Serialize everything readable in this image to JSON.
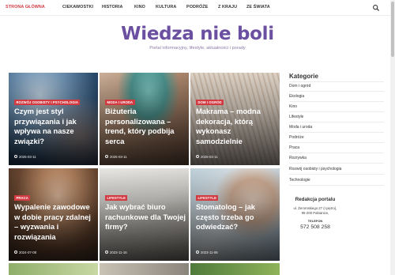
{
  "nav": {
    "items": [
      {
        "label": "STRONA GŁÓWNA",
        "active": true
      },
      {
        "label": "CIEKAWOSTKI",
        "active": false
      },
      {
        "label": "HISTORIA",
        "active": false
      },
      {
        "label": "KINO",
        "active": false
      },
      {
        "label": "KULTURA",
        "active": false
      },
      {
        "label": "PODRÓŻE",
        "active": false
      },
      {
        "label": "Z KRAJU",
        "active": false
      },
      {
        "label": "ZE ŚWIATA",
        "active": false
      }
    ],
    "search_icon": "search-icon"
  },
  "header": {
    "title": "Wiedza nie boli",
    "tagline": "Portal informacyjny, lifestyle, aktualności i porady"
  },
  "cards": [
    {
      "category": "ROZWÓJ OSOBISTY I PSYCHOLOGIA",
      "title": "Czym jest styl przywiązania i jak wpływa na nasze związki?",
      "date": "2025-03-11"
    },
    {
      "category": "MODA I URODA",
      "title": "Biżuteria personalizowana – trend, który podbija serca",
      "date": "2025-03-11"
    },
    {
      "category": "DOM I OGRÓD",
      "title": "Makrama – modna dekoracja, którą wykonasz samodzielnie",
      "date": "2025-03-11"
    },
    {
      "category": "PRACA",
      "title": "Wypalenie zawodowe w dobie pracy zdalnej – wyzwania i rozwiązania",
      "date": "2024-07-08"
    },
    {
      "category": "LIFESTYLE",
      "title": "Jak wybrać biuro rachunkowe dla Twojej firmy?",
      "date": "2023-11-16"
    },
    {
      "category": "LIFESTYLE",
      "title": "Stomatolog – jak często trzeba go odwiedzać?",
      "date": "2023-11-06"
    }
  ],
  "sidebar": {
    "heading": "Kategorie",
    "categories": [
      "Dom i ogród",
      "Ekologia",
      "Kino",
      "Lifestyle",
      "Moda i uroda",
      "Podróże",
      "Praca",
      "Rozrywka",
      "Rozwój osobisty i psychologia",
      "Technologie"
    ],
    "redakcja": {
      "title": "Redakcja portalu",
      "address_line1": "ul. Żeromskiego 27 (I piętro),",
      "address_line2": "95-200 Pabianice,",
      "phone_label": "TELEFON",
      "phone": "572 508 258"
    }
  },
  "colors": {
    "accent": "#d23a42",
    "title": "#6b4fa0"
  }
}
